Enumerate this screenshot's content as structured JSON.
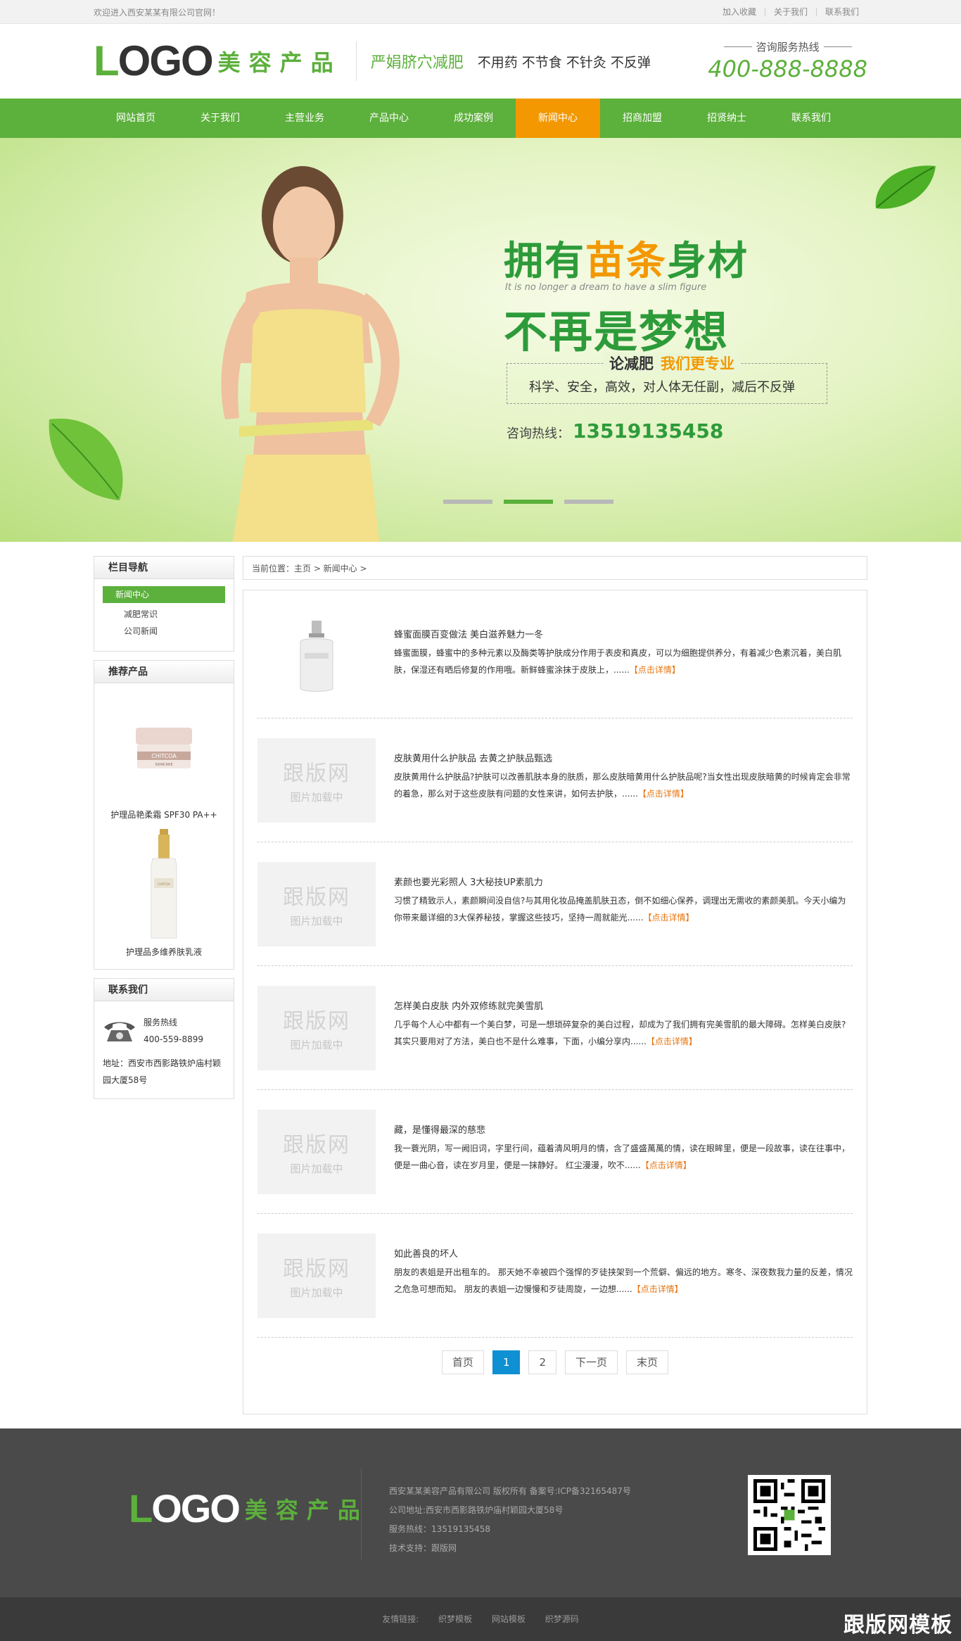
{
  "topbar": {
    "welcome": "欢迎进入西安某某有限公司官网！",
    "links": [
      "加入收藏",
      "关于我们",
      "联系我们"
    ]
  },
  "header": {
    "logo_l": "L",
    "logo_rest": "OGO",
    "logo_cn": "美容产品",
    "slogan1": "严娟脐穴减肥",
    "slogan2": "不用药 不节食 不针灸 不反弹",
    "hotline_label": "咨询服务热线",
    "hotline_number": "400-888-8888"
  },
  "nav": {
    "items": [
      "网站首页",
      "关于我们",
      "主营业务",
      "产品中心",
      "成功案例",
      "新闻中心",
      "招商加盟",
      "招贤纳士",
      "联系我们"
    ],
    "active_index": 5
  },
  "banner": {
    "title1_a": "拥有",
    "title1_hl": "苗条",
    "title1_b": "身材",
    "subtitle": "It is no longer a dream to have a slim figure",
    "title2": "不再是梦想",
    "box_title": "论减肥",
    "box_title_hl": "我们更专业",
    "box_text": "科学、安全，高效，对人体无任副，减后不反弹",
    "hotline_label": "咨询热线：",
    "hotline_number": "13519135458",
    "active_slide": 2,
    "slide_count": 3
  },
  "sidebar": {
    "nav_title": "栏目导航",
    "nav_active": "新闻中心",
    "nav_items": [
      "减肥常识",
      "公司新闻"
    ],
    "products_title": "推荐产品",
    "products": [
      {
        "name": "护理品艳柔霜 SPF30 PA++",
        "brand": "CHITCOA",
        "brand_sub": "SKINCARE"
      },
      {
        "name": "护理品多维养肤乳液",
        "brand": "CHITCOA",
        "brand_sub": ""
      }
    ],
    "contact_title": "联系我们",
    "contact_label": "服务热线",
    "contact_phone": "400-559-8899",
    "contact_address": "地址：西安市西影路铁炉庙村颖园大厦58号"
  },
  "breadcrumb": "当前位置：主页 > 新闻中心 >",
  "placeholder": {
    "big": "跟版网",
    "small": "图片加载中"
  },
  "news": [
    {
      "title": "蜂蜜面膜百变做法 美白滋养魅力一冬",
      "desc": "蜂蜜面膜，蜂蜜中的多种元素以及酶类等护肤成分作用于表皮和真皮，可以为细胞提供养分，有着减少色素沉着，美白肌肤，保湿还有晒后修复的作用哦。新鲜蜂蜜涂抹于皮肤上，......",
      "more": "【点击详情】",
      "has_photo": true
    },
    {
      "title": "皮肤黄用什么护肤品 去黄之护肤品甄选",
      "desc": "皮肤黄用什么护肤品?护肤可以改善肌肤本身的肤质，那么皮肤暗黄用什么护肤品呢?当女性出现皮肤暗黄的时候肯定会非常的着急，那么对于这些皮肤有问题的女性来讲，如何去护肤，......",
      "more": "【点击详情】",
      "has_photo": false
    },
    {
      "title": "素颜也要光彩照人 3大秘技UP素肌力",
      "desc": "习惯了精致示人，素颜瞬间没自信?与其用化妆品掩盖肌肤丑态，倒不如细心保养，调理出无需收的素颜美肌。今天小编为你带来最详细的3大保养秘技，掌握这些技巧，坚持一周就能光......",
      "more": "【点击详情】",
      "has_photo": false
    },
    {
      "title": "怎样美白皮肤 内外双修练就完美雪肌",
      "desc": "几乎每个人心中都有一个美白梦，可是一想琐碎复杂的美白过程，却成为了我们拥有完美雪肌的最大障碍。怎样美白皮肤?其实只要用对了方法，美白也不是什么难事，下面，小编分享内......",
      "more": "【点击详情】",
      "has_photo": false
    },
    {
      "title": "藏，是懂得最深的慈悲",
      "desc": "我一蓑光阴，写一阙旧词，字里行间，蕴着清风明月的情，含了盛盛萬萬的情，读在眼眸里，便是一段故事，读在往事中，便是一曲心音，读在岁月里，便是一抹静好。 红尘漫漫，吹不......",
      "more": "【点击详情】",
      "has_photo": false
    },
    {
      "title": "如此善良的坏人",
      "desc": "朋友的表姐是开出租车的。 那天她不幸被四个强悍的歹徒挟架到一个荒僻、偏远的地方。寒冬、深夜数我力量的反差，情况之危急可想而知。 朋友的表姐一边慢慢和歹徒周旋，一边想......",
      "more": "【点击详情】",
      "has_photo": false
    }
  ],
  "pager": {
    "first": "首页",
    "pages": [
      "1",
      "2"
    ],
    "current": "1",
    "next": "下一页",
    "last": "末页"
  },
  "footer": {
    "logo_l": "L",
    "logo_rest": "OGO",
    "logo_cn": "美容产品",
    "lines": [
      "西安某某美容产品有限公司 版权所有    备案号:ICP备32165487号",
      "公司地址:西安市西影路铁炉庙村颖园大厦58号",
      "服务热线：13519135458",
      "技术支持：跟版网"
    ],
    "friend_label": "友情链接:",
    "friend_links": [
      "织梦模板",
      "网站模板",
      "织梦源码"
    ],
    "watermark": "跟版网模板"
  },
  "colors": {
    "primary": "#5cb03c",
    "accent": "#f39800",
    "more": "#e8730c",
    "pager_active": "#0e90d2"
  }
}
